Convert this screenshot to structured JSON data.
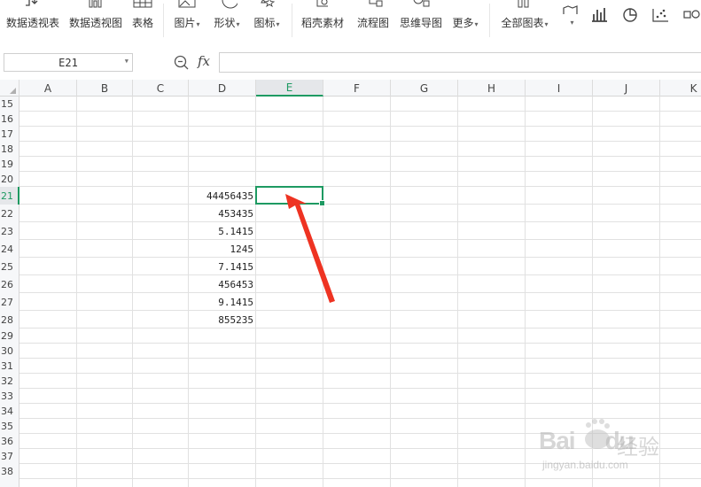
{
  "ribbon": {
    "items": [
      {
        "label": "数据透视表",
        "icon": "pivot-table-icon",
        "caret": false
      },
      {
        "label": "数据透视图",
        "icon": "pivot-chart-icon",
        "caret": false
      },
      {
        "label": "表格",
        "icon": "table-icon",
        "caret": false
      },
      {
        "label": "图片",
        "icon": "picture-icon",
        "caret": true
      },
      {
        "label": "形状",
        "icon": "shape-icon",
        "caret": true
      },
      {
        "label": "图标",
        "icon": "icon-library-icon",
        "caret": true
      },
      {
        "label": "稻壳素材",
        "icon": "docer-material-icon",
        "caret": false
      },
      {
        "label": "流程图",
        "icon": "flowchart-icon",
        "caret": false
      },
      {
        "label": "思维导图",
        "icon": "mindmap-icon",
        "caret": false
      },
      {
        "label": "更多",
        "icon": "more-icon",
        "caret": true
      },
      {
        "label": "全部图表",
        "icon": "all-charts-icon",
        "caret": true
      }
    ],
    "caret_glyph": "▾"
  },
  "formula_bar": {
    "name_box": "E21",
    "fx_label": "fx",
    "formula": ""
  },
  "columns": [
    "A",
    "B",
    "C",
    "D",
    "E",
    "F",
    "G",
    "H",
    "I",
    "J",
    "K"
  ],
  "selected_column": "E",
  "rows": [
    "15",
    "16",
    "17",
    "18",
    "19",
    "20",
    "21",
    "22",
    "23",
    "24",
    "25",
    "26",
    "27",
    "28",
    "29",
    "30",
    "31",
    "32",
    "33",
    "34",
    "35",
    "36",
    "37",
    "38"
  ],
  "selected_row": "21",
  "column_d_values": [
    {
      "row": "21",
      "value": "44456435"
    },
    {
      "row": "22",
      "value": "453435"
    },
    {
      "row": "23",
      "value": "5.1415"
    },
    {
      "row": "24",
      "value": "1245"
    },
    {
      "row": "25",
      "value": "7.1415"
    },
    {
      "row": "26",
      "value": "456453"
    },
    {
      "row": "27",
      "value": "9.1415"
    },
    {
      "row": "28",
      "value": "855235"
    }
  ],
  "active_cell": "E21",
  "annotation": {
    "color": "#ee3322"
  },
  "watermark": {
    "brand": "Bai",
    "brand2": "du",
    "cn": "经验",
    "url": "jingyan.baidu.com"
  },
  "colors": {
    "accent": "#1e9a62"
  }
}
